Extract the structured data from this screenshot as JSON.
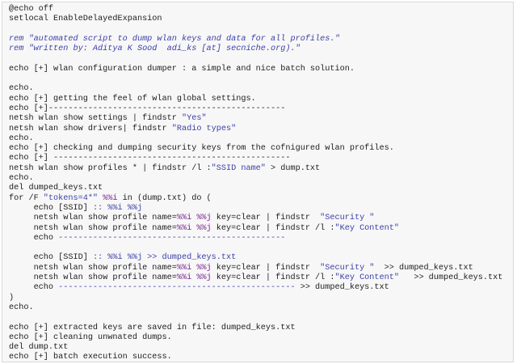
{
  "colors": {
    "background": "#f7f7f7",
    "keyword": "#1d1d1d",
    "string": "#3b3fa8",
    "variable": "#7a2a8f"
  },
  "lines": [
    [
      {
        "t": "@echo off",
        "c": "k"
      }
    ],
    [
      {
        "t": "setlocal EnableDelayedExpansion",
        "c": "k"
      }
    ],
    [],
    [
      {
        "t": "rem \"automated script to dump wlan keys and data for all profiles.\"",
        "c": "c"
      }
    ],
    [
      {
        "t": "rem \"written by: Aditya K Sood  adi_ks [at] secniche.org).\"",
        "c": "c"
      }
    ],
    [],
    [
      {
        "t": "echo [+] wlan configuration dumper : a simple and nice batch solution.",
        "c": "k"
      }
    ],
    [],
    [
      {
        "t": "echo.",
        "c": "k"
      }
    ],
    [
      {
        "t": "echo [+] getting the feel of wlan global settings.",
        "c": "k"
      }
    ],
    [
      {
        "t": "echo [+]------------------------------------------------",
        "c": "k"
      }
    ],
    [
      {
        "t": "netsh wlan show settings | findstr ",
        "c": "k"
      },
      {
        "t": "\"Yes\"",
        "c": "s"
      }
    ],
    [
      {
        "t": "netsh wlan show drivers| findstr ",
        "c": "k"
      },
      {
        "t": "\"Radio types\"",
        "c": "s"
      }
    ],
    [
      {
        "t": "echo.",
        "c": "k"
      }
    ],
    [
      {
        "t": "echo [+] checking and dumping security keys from the cofnigured wlan profiles.",
        "c": "k"
      }
    ],
    [
      {
        "t": "echo [+] ------------------------------------------------",
        "c": "k"
      }
    ],
    [
      {
        "t": "netsh wlan show profiles * | findstr /l :",
        "c": "k"
      },
      {
        "t": "\"SSID name\"",
        "c": "s"
      },
      {
        "t": " > dump.txt",
        "c": "k"
      }
    ],
    [
      {
        "t": "echo.",
        "c": "k"
      }
    ],
    [
      {
        "t": "del dumped_keys.txt",
        "c": "k"
      }
    ],
    [
      {
        "t": "for /F ",
        "c": "k"
      },
      {
        "t": "\"tokens=4*\"",
        "c": "s"
      },
      {
        "t": " ",
        "c": "k"
      },
      {
        "t": "%%i",
        "c": "v"
      },
      {
        "t": " in (dump.txt) do (",
        "c": "k"
      }
    ],
    [
      {
        "t": "     echo [SSID] ",
        "c": "k"
      },
      {
        "t": ":: %%i %%j",
        "c": "s"
      }
    ],
    [
      {
        "t": "     netsh wlan show profile name=",
        "c": "k"
      },
      {
        "t": "%%i %%j",
        "c": "v"
      },
      {
        "t": " key=clear | findstr  ",
        "c": "k"
      },
      {
        "t": "\"Security \"",
        "c": "s"
      }
    ],
    [
      {
        "t": "     netsh wlan show profile name=",
        "c": "k"
      },
      {
        "t": "%%i %%j",
        "c": "v"
      },
      {
        "t": " key=clear | findstr /l :",
        "c": "k"
      },
      {
        "t": "\"Key Content\"",
        "c": "s"
      }
    ],
    [
      {
        "t": "     echo ",
        "c": "k"
      },
      {
        "t": "----------------------------------------------",
        "c": "s"
      }
    ],
    [],
    [
      {
        "t": "     echo [SSID] ",
        "c": "k"
      },
      {
        "t": ":: %%i %%j >> dumped_keys.txt",
        "c": "s"
      }
    ],
    [
      {
        "t": "     netsh wlan show profile name=",
        "c": "k"
      },
      {
        "t": "%%i %%j",
        "c": "v"
      },
      {
        "t": " key=clear | findstr  ",
        "c": "k"
      },
      {
        "t": "\"Security \"",
        "c": "s"
      },
      {
        "t": "  >> dumped_keys.txt",
        "c": "k"
      }
    ],
    [
      {
        "t": "     netsh wlan show profile name=",
        "c": "k"
      },
      {
        "t": "%%i %%j",
        "c": "v"
      },
      {
        "t": " key=clear | findstr /l :",
        "c": "k"
      },
      {
        "t": "\"Key Content\"",
        "c": "s"
      },
      {
        "t": "   >> dumped_keys.txt",
        "c": "k"
      }
    ],
    [
      {
        "t": "     echo ",
        "c": "k"
      },
      {
        "t": "------------------------------------------------",
        "c": "s"
      },
      {
        "t": " >> dumped_keys.txt",
        "c": "k"
      }
    ],
    [
      {
        "t": ")",
        "c": "k"
      }
    ],
    [
      {
        "t": "echo.",
        "c": "k"
      }
    ],
    [],
    [
      {
        "t": "echo [+] extracted keys are saved in file: dumped_keys.txt",
        "c": "k"
      }
    ],
    [
      {
        "t": "echo [+] cleaning unwnated dumps.",
        "c": "k"
      }
    ],
    [
      {
        "t": "del dump.txt",
        "c": "k"
      }
    ],
    [
      {
        "t": "echo [+] batch execution success.",
        "c": "k"
      }
    ]
  ]
}
